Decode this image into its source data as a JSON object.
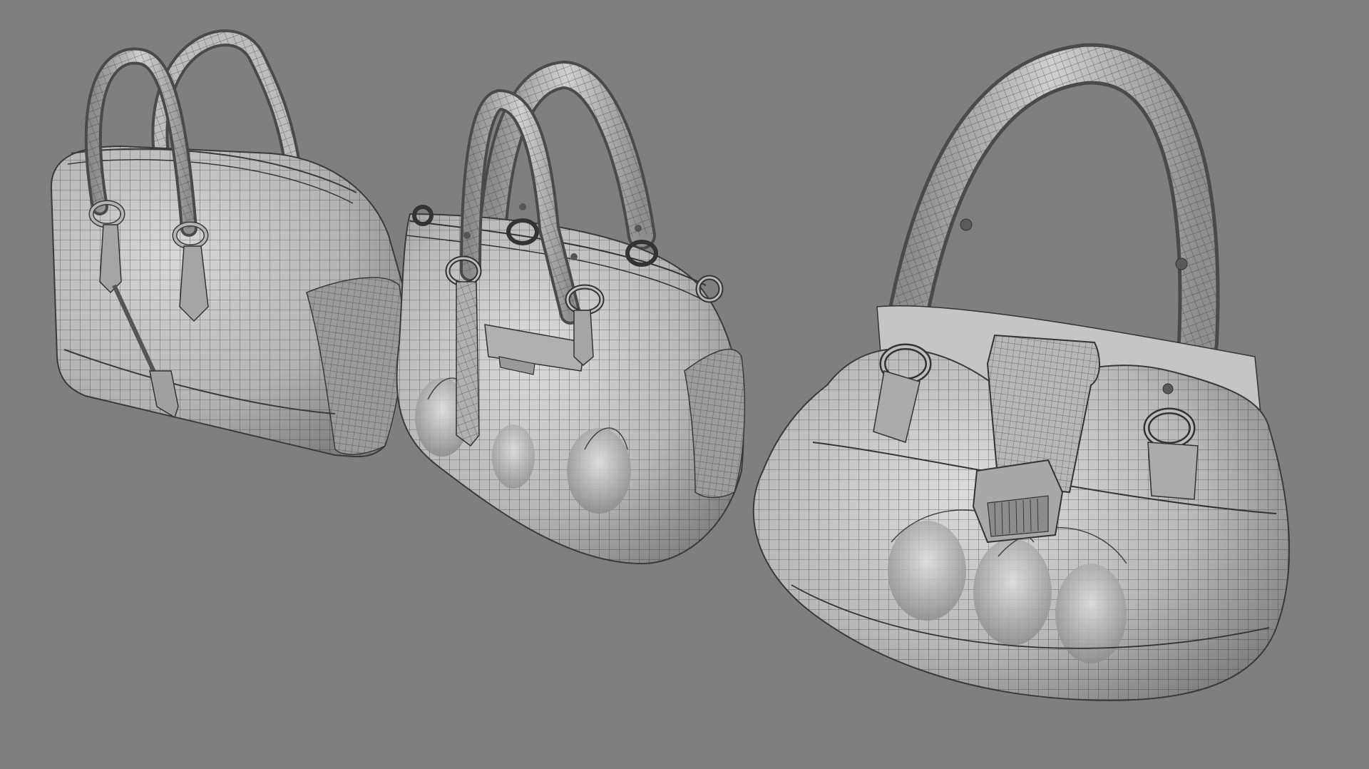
{
  "scene": {
    "background_color": "#7f7f7f",
    "wire_color": "#2a2a2a",
    "shade_light": "#d6d6d6",
    "shade_mid": "#a9a9a9",
    "shade_dark": "#5c5c5c",
    "models": [
      {
        "name": "boston-bag",
        "icon": "handbag-wireframe"
      },
      {
        "name": "tote-bag",
        "icon": "handbag-wireframe"
      },
      {
        "name": "hobo-bag",
        "icon": "handbag-wireframe"
      }
    ]
  }
}
